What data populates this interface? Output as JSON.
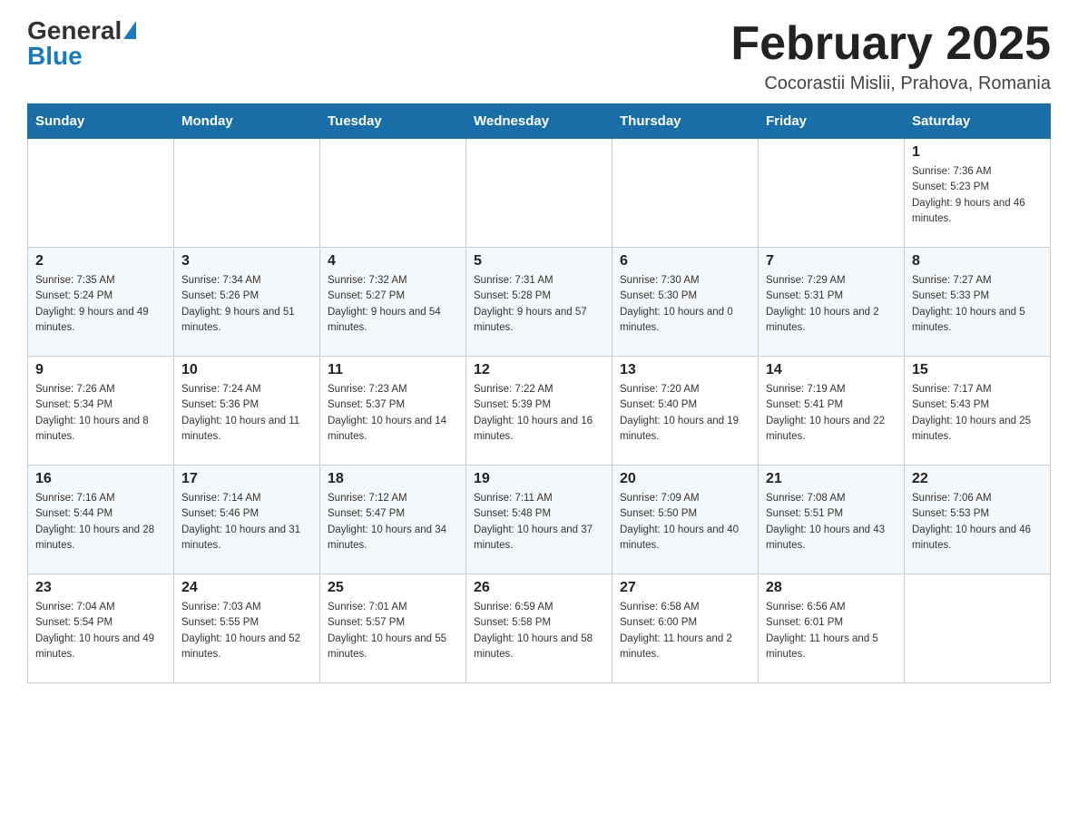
{
  "header": {
    "logo_general": "General",
    "logo_blue": "Blue",
    "month_title": "February 2025",
    "location": "Cocorastii Mislii, Prahova, Romania"
  },
  "days_of_week": [
    "Sunday",
    "Monday",
    "Tuesday",
    "Wednesday",
    "Thursday",
    "Friday",
    "Saturday"
  ],
  "weeks": [
    {
      "days": [
        {
          "num": "",
          "info": ""
        },
        {
          "num": "",
          "info": ""
        },
        {
          "num": "",
          "info": ""
        },
        {
          "num": "",
          "info": ""
        },
        {
          "num": "",
          "info": ""
        },
        {
          "num": "",
          "info": ""
        },
        {
          "num": "1",
          "info": "Sunrise: 7:36 AM\nSunset: 5:23 PM\nDaylight: 9 hours and 46 minutes."
        }
      ]
    },
    {
      "days": [
        {
          "num": "2",
          "info": "Sunrise: 7:35 AM\nSunset: 5:24 PM\nDaylight: 9 hours and 49 minutes."
        },
        {
          "num": "3",
          "info": "Sunrise: 7:34 AM\nSunset: 5:26 PM\nDaylight: 9 hours and 51 minutes."
        },
        {
          "num": "4",
          "info": "Sunrise: 7:32 AM\nSunset: 5:27 PM\nDaylight: 9 hours and 54 minutes."
        },
        {
          "num": "5",
          "info": "Sunrise: 7:31 AM\nSunset: 5:28 PM\nDaylight: 9 hours and 57 minutes."
        },
        {
          "num": "6",
          "info": "Sunrise: 7:30 AM\nSunset: 5:30 PM\nDaylight: 10 hours and 0 minutes."
        },
        {
          "num": "7",
          "info": "Sunrise: 7:29 AM\nSunset: 5:31 PM\nDaylight: 10 hours and 2 minutes."
        },
        {
          "num": "8",
          "info": "Sunrise: 7:27 AM\nSunset: 5:33 PM\nDaylight: 10 hours and 5 minutes."
        }
      ]
    },
    {
      "days": [
        {
          "num": "9",
          "info": "Sunrise: 7:26 AM\nSunset: 5:34 PM\nDaylight: 10 hours and 8 minutes."
        },
        {
          "num": "10",
          "info": "Sunrise: 7:24 AM\nSunset: 5:36 PM\nDaylight: 10 hours and 11 minutes."
        },
        {
          "num": "11",
          "info": "Sunrise: 7:23 AM\nSunset: 5:37 PM\nDaylight: 10 hours and 14 minutes."
        },
        {
          "num": "12",
          "info": "Sunrise: 7:22 AM\nSunset: 5:39 PM\nDaylight: 10 hours and 16 minutes."
        },
        {
          "num": "13",
          "info": "Sunrise: 7:20 AM\nSunset: 5:40 PM\nDaylight: 10 hours and 19 minutes."
        },
        {
          "num": "14",
          "info": "Sunrise: 7:19 AM\nSunset: 5:41 PM\nDaylight: 10 hours and 22 minutes."
        },
        {
          "num": "15",
          "info": "Sunrise: 7:17 AM\nSunset: 5:43 PM\nDaylight: 10 hours and 25 minutes."
        }
      ]
    },
    {
      "days": [
        {
          "num": "16",
          "info": "Sunrise: 7:16 AM\nSunset: 5:44 PM\nDaylight: 10 hours and 28 minutes."
        },
        {
          "num": "17",
          "info": "Sunrise: 7:14 AM\nSunset: 5:46 PM\nDaylight: 10 hours and 31 minutes."
        },
        {
          "num": "18",
          "info": "Sunrise: 7:12 AM\nSunset: 5:47 PM\nDaylight: 10 hours and 34 minutes."
        },
        {
          "num": "19",
          "info": "Sunrise: 7:11 AM\nSunset: 5:48 PM\nDaylight: 10 hours and 37 minutes."
        },
        {
          "num": "20",
          "info": "Sunrise: 7:09 AM\nSunset: 5:50 PM\nDaylight: 10 hours and 40 minutes."
        },
        {
          "num": "21",
          "info": "Sunrise: 7:08 AM\nSunset: 5:51 PM\nDaylight: 10 hours and 43 minutes."
        },
        {
          "num": "22",
          "info": "Sunrise: 7:06 AM\nSunset: 5:53 PM\nDaylight: 10 hours and 46 minutes."
        }
      ]
    },
    {
      "days": [
        {
          "num": "23",
          "info": "Sunrise: 7:04 AM\nSunset: 5:54 PM\nDaylight: 10 hours and 49 minutes."
        },
        {
          "num": "24",
          "info": "Sunrise: 7:03 AM\nSunset: 5:55 PM\nDaylight: 10 hours and 52 minutes."
        },
        {
          "num": "25",
          "info": "Sunrise: 7:01 AM\nSunset: 5:57 PM\nDaylight: 10 hours and 55 minutes."
        },
        {
          "num": "26",
          "info": "Sunrise: 6:59 AM\nSunset: 5:58 PM\nDaylight: 10 hours and 58 minutes."
        },
        {
          "num": "27",
          "info": "Sunrise: 6:58 AM\nSunset: 6:00 PM\nDaylight: 11 hours and 2 minutes."
        },
        {
          "num": "28",
          "info": "Sunrise: 6:56 AM\nSunset: 6:01 PM\nDaylight: 11 hours and 5 minutes."
        },
        {
          "num": "",
          "info": ""
        }
      ]
    }
  ]
}
